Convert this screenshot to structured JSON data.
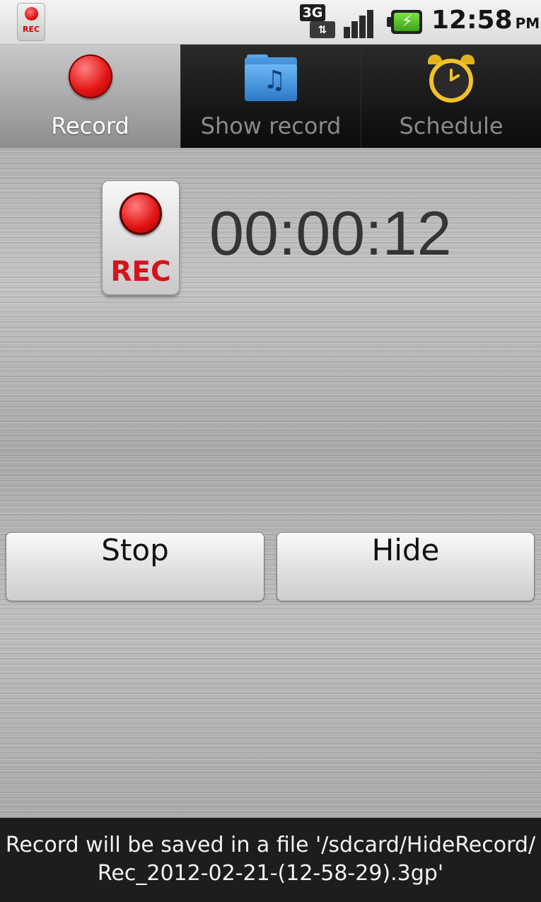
{
  "status_bar": {
    "notification_rec_label": "REC",
    "network_type": "3G",
    "time": "12:58",
    "ampm": "PM"
  },
  "tabs": [
    {
      "label": "Record",
      "icon": "record-dot-icon",
      "active": true
    },
    {
      "label": "Show record",
      "icon": "music-folder-icon",
      "active": false
    },
    {
      "label": "Schedule",
      "icon": "alarm-clock-icon",
      "active": false
    }
  ],
  "recorder": {
    "badge_label": "REC",
    "elapsed": "00:00:12"
  },
  "buttons": {
    "stop_label": "Stop",
    "hide_label": "Hide"
  },
  "toast": {
    "line1": "Record will be saved in a file '/sdcard/HideRecord/",
    "line2": "Rec_2012-02-21-(12-58-29).3gp'"
  },
  "colors": {
    "accent_red": "#e11212",
    "tab_active_bg": "#b0b0b0",
    "tab_inactive_bg": "#151515",
    "toast_bg": "#1d1d1d"
  }
}
